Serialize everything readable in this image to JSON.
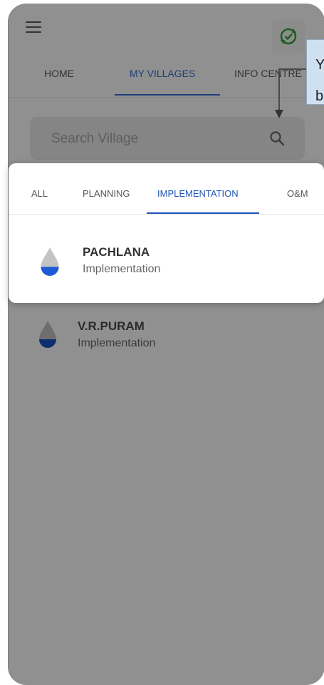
{
  "header": {
    "menu_icon": "hamburger-menu-icon",
    "sync_icon": "sync-check-icon",
    "sync_color": "#2e7d32"
  },
  "tabs": [
    {
      "label": "HOME",
      "active": false
    },
    {
      "label": "MY VILLAGES",
      "active": true
    },
    {
      "label": "INFO CENTRE",
      "active": false
    }
  ],
  "search": {
    "placeholder": "Search Village",
    "icon": "search-icon"
  },
  "tooltip": {
    "line1": "Y",
    "line2": "b"
  },
  "filter_tabs": [
    {
      "label": "ALL",
      "active": false
    },
    {
      "label": "PLANNING",
      "active": false
    },
    {
      "label": "IMPLEMENTATION",
      "active": true
    },
    {
      "label": "O&M",
      "active": false
    }
  ],
  "villages": [
    {
      "name": "PACHLANA",
      "status": "Implementation",
      "icon": "water-drop-icon"
    },
    {
      "name": "V.R.PURAM",
      "status": "Implementation",
      "icon": "water-drop-icon"
    }
  ],
  "colors": {
    "active_tab": "#1d3f7a",
    "filter_active": "#1e56b9",
    "drop_fill": "#1e5bd6"
  }
}
